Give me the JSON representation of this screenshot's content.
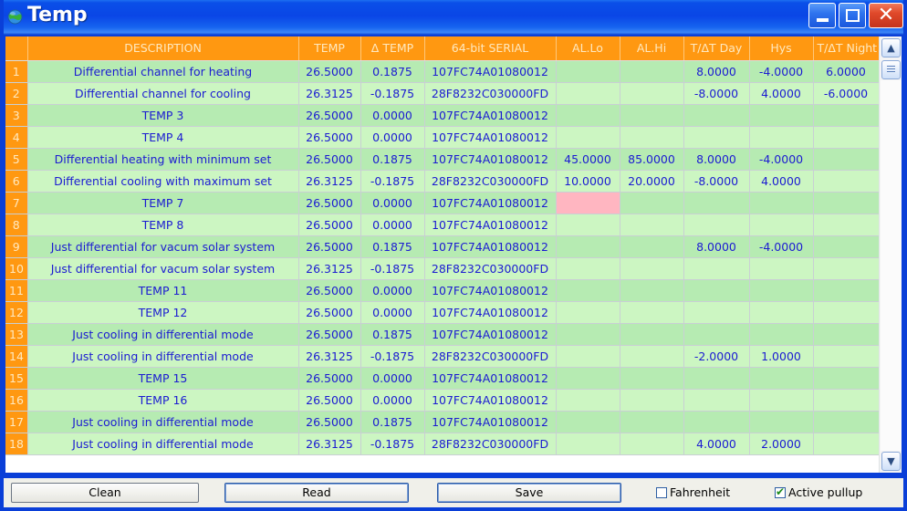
{
  "window": {
    "title": "Temp",
    "icon": "globe-icon",
    "minimize_label": "–",
    "maximize_label": "❑",
    "close_label": "✕",
    "accent_color": "#0a3fd8",
    "header_color": "#ff9811",
    "row_color_odd": "#b6ebb2",
    "row_color_even": "#ccf6c2",
    "alert_color": "#ffb6c1",
    "text_color": "#1b1bd2"
  },
  "grid": {
    "columns": [
      {
        "key": "num",
        "label": ""
      },
      {
        "key": "desc",
        "label": "DESCRIPTION"
      },
      {
        "key": "temp",
        "label": "TEMP"
      },
      {
        "key": "dtemp",
        "label": "Δ TEMP"
      },
      {
        "key": "serial",
        "label": "64-bit SERIAL"
      },
      {
        "key": "allo",
        "label": "AL.Lo"
      },
      {
        "key": "alhi",
        "label": "AL.Hi"
      },
      {
        "key": "tday",
        "label": "T/ΔT Day"
      },
      {
        "key": "hys",
        "label": "Hys"
      },
      {
        "key": "tnight",
        "label": "T/ΔT Night"
      }
    ],
    "rows": [
      {
        "num": "1",
        "desc": "Differential channel for heating",
        "temp": "26.5000",
        "dtemp": "0.1875",
        "serial": "107FC74A01080012",
        "allo": "",
        "alhi": "",
        "tday": "8.0000",
        "hys": "-4.0000",
        "tnight": "6.0000",
        "alert": ""
      },
      {
        "num": "2",
        "desc": "Differential channel for cooling",
        "temp": "26.3125",
        "dtemp": "-0.1875",
        "serial": "28F8232C030000FD",
        "allo": "",
        "alhi": "",
        "tday": "-8.0000",
        "hys": "4.0000",
        "tnight": "-6.0000",
        "alert": ""
      },
      {
        "num": "3",
        "desc": "TEMP 3",
        "temp": "26.5000",
        "dtemp": "0.0000",
        "serial": "107FC74A01080012",
        "allo": "",
        "alhi": "",
        "tday": "",
        "hys": "",
        "tnight": "",
        "alert": ""
      },
      {
        "num": "4",
        "desc": "TEMP 4",
        "temp": "26.5000",
        "dtemp": "0.0000",
        "serial": "107FC74A01080012",
        "allo": "",
        "alhi": "",
        "tday": "",
        "hys": "",
        "tnight": "",
        "alert": ""
      },
      {
        "num": "5",
        "desc": "Differential  heating with minimum set",
        "temp": "26.5000",
        "dtemp": "0.1875",
        "serial": "107FC74A01080012",
        "allo": "45.0000",
        "alhi": "85.0000",
        "tday": "8.0000",
        "hys": "-4.0000",
        "tnight": "",
        "alert": ""
      },
      {
        "num": "6",
        "desc": "Differential cooling with maximum set",
        "temp": "26.3125",
        "dtemp": "-0.1875",
        "serial": "28F8232C030000FD",
        "allo": "10.0000",
        "alhi": "20.0000",
        "tday": "-8.0000",
        "hys": "4.0000",
        "tnight": "",
        "alert": ""
      },
      {
        "num": "7",
        "desc": "TEMP 7",
        "temp": "26.5000",
        "dtemp": "0.0000",
        "serial": "107FC74A01080012",
        "allo": "",
        "alhi": "",
        "tday": "",
        "hys": "",
        "tnight": "",
        "alert": "allo"
      },
      {
        "num": "8",
        "desc": "TEMP 8",
        "temp": "26.5000",
        "dtemp": "0.0000",
        "serial": "107FC74A01080012",
        "allo": "",
        "alhi": "",
        "tday": "",
        "hys": "",
        "tnight": "",
        "alert": ""
      },
      {
        "num": "9",
        "desc": "Just differential for vacum solar system",
        "temp": "26.5000",
        "dtemp": "0.1875",
        "serial": "107FC74A01080012",
        "allo": "",
        "alhi": "",
        "tday": "8.0000",
        "hys": "-4.0000",
        "tnight": "",
        "alert": ""
      },
      {
        "num": "10",
        "desc": "Just differential for vacum solar system",
        "temp": "26.3125",
        "dtemp": "-0.1875",
        "serial": "28F8232C030000FD",
        "allo": "",
        "alhi": "",
        "tday": "",
        "hys": "",
        "tnight": "",
        "alert": ""
      },
      {
        "num": "11",
        "desc": "TEMP 11",
        "temp": "26.5000",
        "dtemp": "0.0000",
        "serial": "107FC74A01080012",
        "allo": "",
        "alhi": "",
        "tday": "",
        "hys": "",
        "tnight": "",
        "alert": ""
      },
      {
        "num": "12",
        "desc": "TEMP 12",
        "temp": "26.5000",
        "dtemp": "0.0000",
        "serial": "107FC74A01080012",
        "allo": "",
        "alhi": "",
        "tday": "",
        "hys": "",
        "tnight": "",
        "alert": ""
      },
      {
        "num": "13",
        "desc": "Just cooling in differential mode",
        "temp": "26.5000",
        "dtemp": "0.1875",
        "serial": "107FC74A01080012",
        "allo": "",
        "alhi": "",
        "tday": "",
        "hys": "",
        "tnight": "",
        "alert": ""
      },
      {
        "num": "14",
        "desc": "Just cooling in differential mode",
        "temp": "26.3125",
        "dtemp": "-0.1875",
        "serial": "28F8232C030000FD",
        "allo": "",
        "alhi": "",
        "tday": "-2.0000",
        "hys": "1.0000",
        "tnight": "",
        "alert": ""
      },
      {
        "num": "15",
        "desc": "TEMP 15",
        "temp": "26.5000",
        "dtemp": "0.0000",
        "serial": "107FC74A01080012",
        "allo": "",
        "alhi": "",
        "tday": "",
        "hys": "",
        "tnight": "",
        "alert": ""
      },
      {
        "num": "16",
        "desc": "TEMP 16",
        "temp": "26.5000",
        "dtemp": "0.0000",
        "serial": "107FC74A01080012",
        "allo": "",
        "alhi": "",
        "tday": "",
        "hys": "",
        "tnight": "",
        "alert": ""
      },
      {
        "num": "17",
        "desc": "Just cooling in differential mode",
        "temp": "26.5000",
        "dtemp": "0.1875",
        "serial": "107FC74A01080012",
        "allo": "",
        "alhi": "",
        "tday": "",
        "hys": "",
        "tnight": "",
        "alert": ""
      },
      {
        "num": "18",
        "desc": "Just cooling in differential mode",
        "temp": "26.3125",
        "dtemp": "-0.1875",
        "serial": "28F8232C030000FD",
        "allo": "",
        "alhi": "",
        "tday": "4.0000",
        "hys": "2.0000",
        "tnight": "",
        "alert": ""
      }
    ]
  },
  "scrollbar": {
    "up_label": "▲",
    "down_label": "▼"
  },
  "toolbar": {
    "clean_label": "Clean",
    "read_label": "Read",
    "save_label": "Save",
    "fahrenheit_label": "Fahrenheit",
    "fahrenheit_checked": false,
    "pullup_label": "Active pullup",
    "pullup_checked": true
  }
}
